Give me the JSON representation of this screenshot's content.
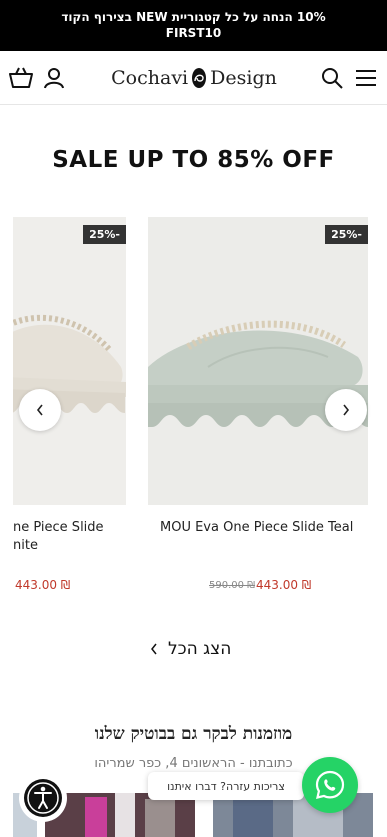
{
  "announcement": {
    "line1": "10% הנחה על כל קטגוריית NEW בצירוף הקוד",
    "line2": "FIRST10"
  },
  "header": {
    "logo_left": "Cochavi",
    "logo_right": "Design",
    "icons": [
      "cart-icon",
      "account-icon",
      "search-icon",
      "menu-icon"
    ]
  },
  "sale": {
    "title": "SALE UP TO 85% OFF"
  },
  "products": [
    {
      "badge": "25%-",
      "title_line1": "ne Piece Slide",
      "title_line2": "nite",
      "price_now": "443.00 ₪",
      "color": "#ecebe6"
    },
    {
      "badge": "25%-",
      "title_line1": "MOU Eva One Piece Slide Teal",
      "price_old": "590.00 ₪",
      "price_now": "443.00 ₪",
      "color": "#c9d3cb"
    }
  ],
  "view_all": {
    "label": "הצג הכל"
  },
  "visit": {
    "title": "מוזמנות לבקר גם בבוטיק שלנו",
    "address": "כתובתנו - הראשונים 4, כפר שמריהו"
  },
  "whatsapp": {
    "tooltip": "צריכות עזרה? דברו איתנו"
  },
  "colors": {
    "accent_price": "#c0392b",
    "whatsapp": "#25d366",
    "announcement_bg": "#000000"
  }
}
